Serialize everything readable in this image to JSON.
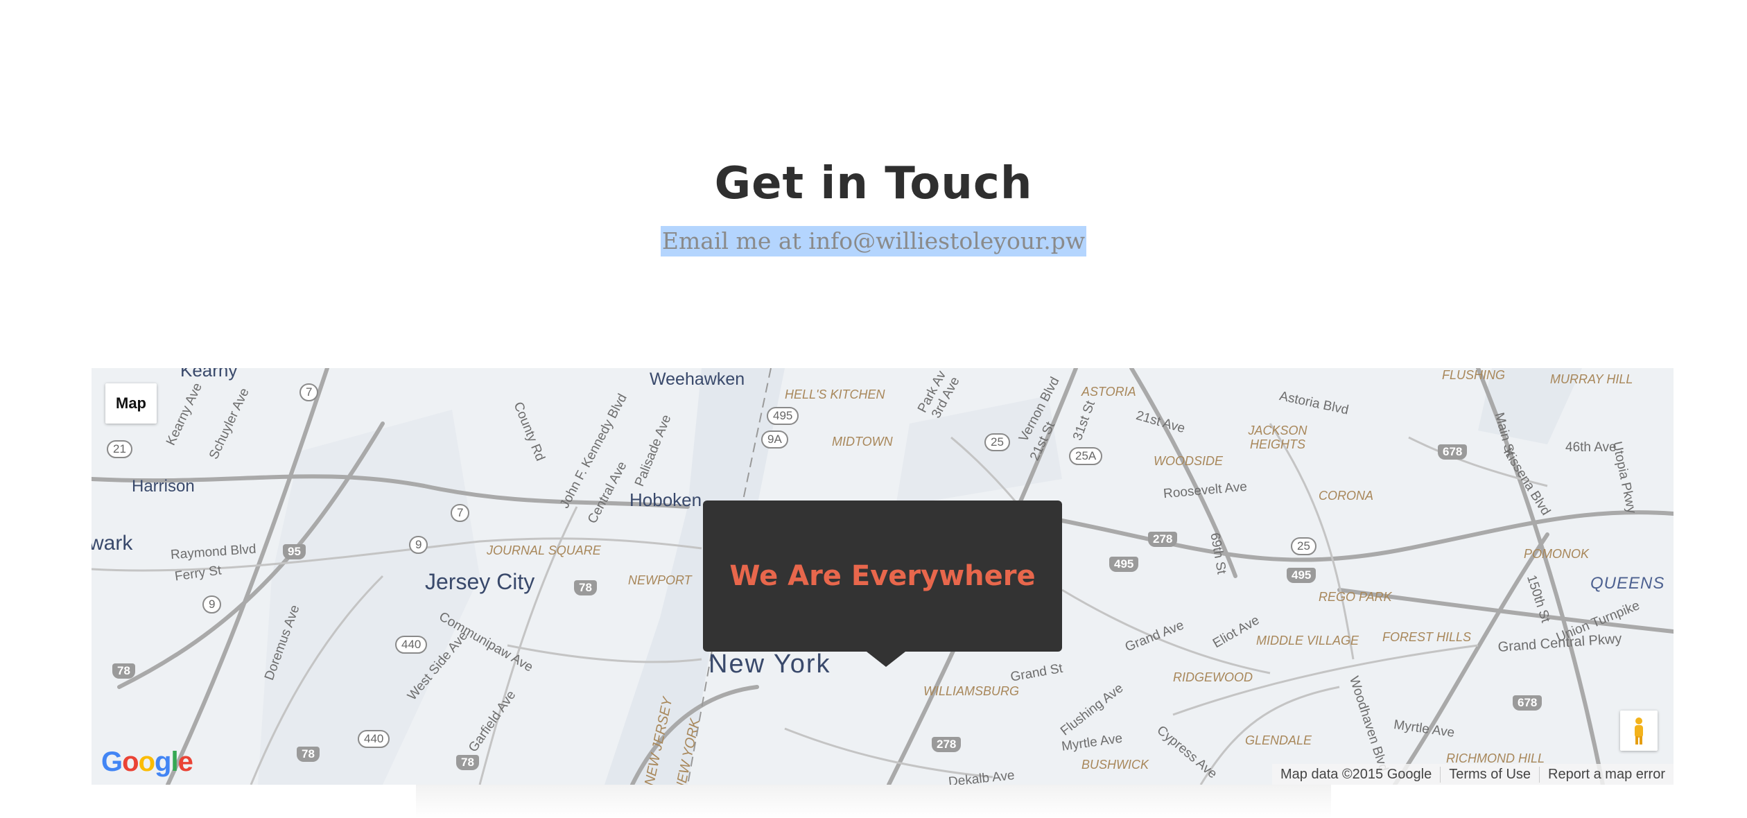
{
  "section": {
    "title": "Get in Touch",
    "email_line": "Email me at info@williestoleyour.pw"
  },
  "map": {
    "type_button": "Map",
    "popup_text": "We Are Everywhere",
    "labels": {
      "kearny": "Kearny",
      "weehawken": "Weehawken",
      "hells_kitchen": "HELL'S KITCHEN",
      "midtown": "MIDTOWN",
      "astoria": "ASTORIA",
      "flushing": "FLUSHING",
      "murray_hill": "MURRAY HILL",
      "astoria_blvd": "Astoria Blvd",
      "harrison": "Harrison",
      "hoboken": "Hoboken",
      "jackson_heights": "JACKSON HEIGHTS",
      "woodside": "WOODSIDE",
      "roosevelt_ave": "Roosevelt Ave",
      "corona": "CORONA",
      "ave_46th": "46th Ave",
      "newark": "wark",
      "raymond_blvd": "Raymond Blvd",
      "ferry_st": "Ferry St",
      "journal_square": "JOURNAL SQUARE",
      "jersey_city": "Jersey City",
      "newport": "NEWPORT",
      "pomonok": "POMONOK",
      "queens": "QUEENS",
      "rego_park": "REGO PARK",
      "middle_village": "MIDDLE VILLAGE",
      "forest_hills": "FOREST HILLS",
      "grand_central_pkwy": "Grand Central Pkwy",
      "new_york": "New York",
      "williamsburg": "WILLIAMSBURG",
      "grand_st": "Grand St",
      "ridgewood": "RIDGEWOOD",
      "glendale": "GLENDALE",
      "richmond_hill": "RICHMOND HILL",
      "bushwick": "BUSHWICK",
      "myrtle_ave": "Myrtle Ave",
      "myrtle_ave_2": "Myrtle Ave",
      "dekalb_ave": "Dekalb Ave",
      "ave_21st": "21st Ave",
      "eliot_ave": "Eliot Ave",
      "grand_ave": "Grand Ave",
      "st_69th": "69th St",
      "main_st": "Main St",
      "kearny_ave": "Kearny Ave",
      "schuyler_ave": "Schuyler Ave",
      "county_rd": "County Rd",
      "jfk_blvd": "John F. Kennedy Blvd",
      "central_ave": "Central Ave",
      "palisade_ave": "Palisade Ave",
      "doremus_ave": "Doremus Ave",
      "communipaw_ave": "Communipaw Ave",
      "west_side_ave": "West Side Ave",
      "garfield_ave": "Garfield Ave",
      "flushing_ave": "Flushing Ave",
      "woodhaven_blvd": "Woodhaven Blvd",
      "union_turnpike": "Union Turnpike",
      "kissena_blvd": "Kissena Blvd",
      "utopia_pkwy": "Utopia Pkwy",
      "vernon_blvd": "Vernon Blvd",
      "park_ave": "Park Av",
      "third_ave": "3rd Ave",
      "st_21st": "21st St",
      "st_31st": "31st St",
      "st_150th": "150th St",
      "cypress_ave": "Cypress Ave",
      "nj": "NEW JERSEY",
      "ny": "NEW YORK"
    },
    "shields": [
      "7",
      "21",
      "495",
      "9A",
      "25",
      "25A",
      "678",
      "7",
      "9",
      "95",
      "278",
      "495",
      "25",
      "495",
      "78",
      "9",
      "440",
      "78",
      "440",
      "78",
      "78",
      "278",
      "678"
    ],
    "google_logo": "Google",
    "attribution": {
      "map_data": "Map data ©2015 Google",
      "terms": "Terms of Use",
      "report": "Report a map error"
    }
  }
}
